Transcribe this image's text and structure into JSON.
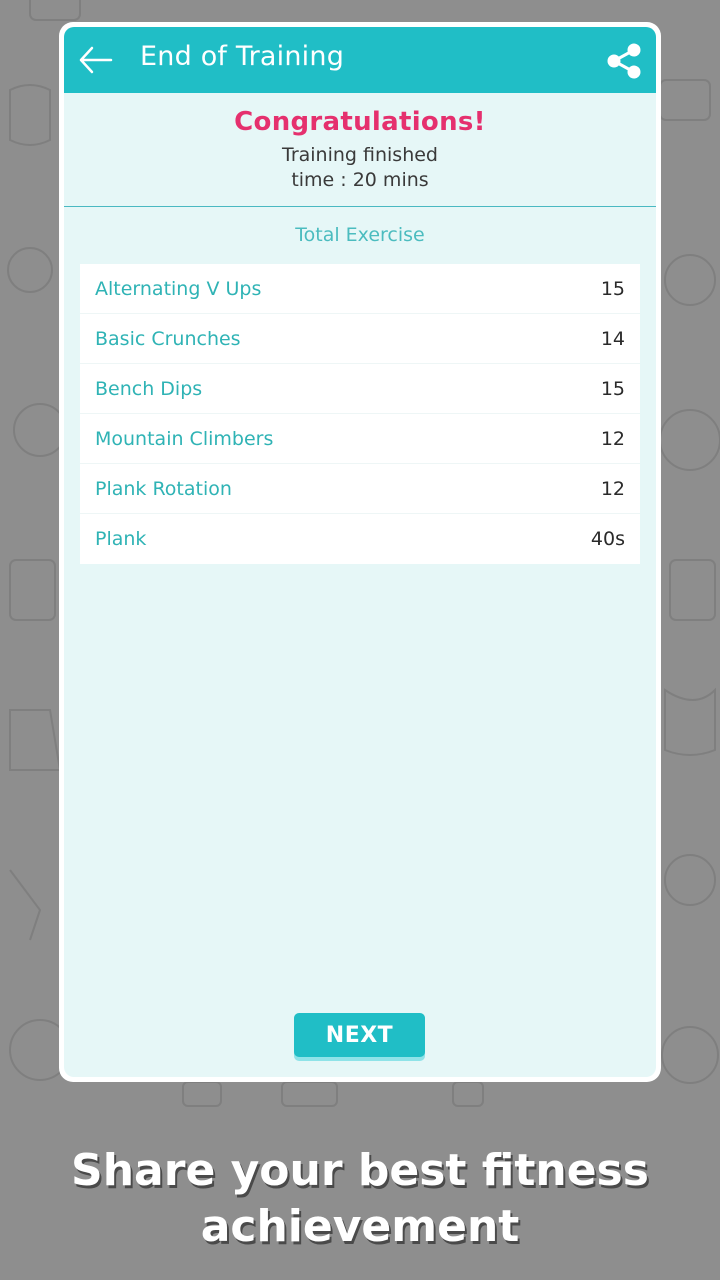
{
  "header": {
    "title": "End of Training",
    "back_icon": "arrow-left-icon",
    "share_icon": "share-icon"
  },
  "summary": {
    "headline": "Congratulations!",
    "status": "Training finished",
    "time": "time : 20 mins"
  },
  "exercises": {
    "heading": "Total Exercise",
    "items": [
      {
        "name": "Alternating V Ups",
        "value": "15"
      },
      {
        "name": "Basic Crunches",
        "value": "14"
      },
      {
        "name": "Bench Dips",
        "value": "15"
      },
      {
        "name": "Mountain Climbers",
        "value": "12"
      },
      {
        "name": "Plank Rotation",
        "value": "12"
      },
      {
        "name": "Plank",
        "value": "40s"
      }
    ]
  },
  "actions": {
    "next_label": "NEXT"
  },
  "promo": {
    "line1": "Share your best fitness",
    "line2": "achievement"
  },
  "colors": {
    "accent": "#20bec6",
    "headline": "#e5306e",
    "exercise_name": "#2fb3b5",
    "panel_bg": "#e6f7f7",
    "backdrop": "#8e8e8e"
  }
}
